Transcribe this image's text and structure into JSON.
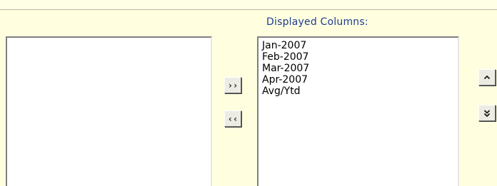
{
  "labels": {
    "displayed_columns": "Displayed Columns:"
  },
  "available_columns": {
    "items": []
  },
  "displayed_columns": {
    "items": [
      "Jan-2007",
      "Feb-2007",
      "Mar-2007",
      "Apr-2007",
      "Avg/Ytd"
    ]
  },
  "buttons": {
    "add_label": "››",
    "remove_label": "‹‹",
    "move_up_icon": "chevron-up-icon",
    "move_down_icon": "chevron-down-icon"
  },
  "colors": {
    "background": "#ffffe0",
    "label_text": "#1f3b8f",
    "list_background": "#ffffff"
  }
}
